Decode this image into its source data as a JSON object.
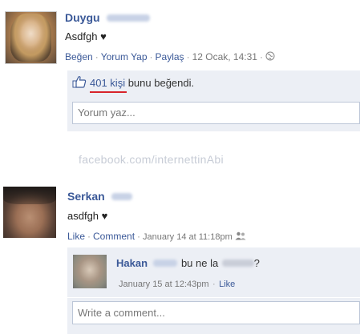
{
  "post1": {
    "author": "Duygu",
    "text": "Asdfgh ♥",
    "actions": {
      "like": "Beğen",
      "comment": "Yorum Yap",
      "share": "Paylaş"
    },
    "timestamp": "12 Ocak, 14:31",
    "likes": {
      "count": "401 kişi",
      "suffix": "bunu beğendi."
    },
    "comment_placeholder": "Yorum yaz..."
  },
  "watermark": "facebook.com/internettinAbi",
  "post2": {
    "author": "Serkan",
    "text": "asdfgh ♥",
    "actions": {
      "like": "Like",
      "comment": "Comment"
    },
    "timestamp": "January 14 at 11:18pm",
    "reply": {
      "author": "Hakan",
      "text_start": "bu ne la",
      "text_end": "?",
      "timestamp": "January 15 at 12:43pm",
      "like": "Like"
    },
    "comment_placeholder": "Write a comment..."
  },
  "colors": {
    "link": "#3b5998",
    "box_bg": "#eceff5",
    "underline": "#d8232a"
  }
}
